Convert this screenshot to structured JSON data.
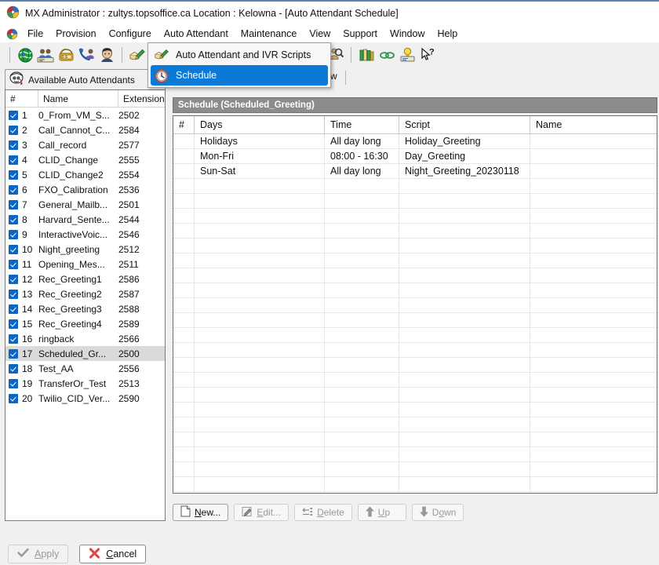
{
  "window": {
    "title": "MX Administrator : zultys.topsoffice.ca   Location : Kelowna - [Auto Attendant Schedule]",
    "app_icon": "mx-administrator-icon"
  },
  "menubar": {
    "items": [
      {
        "label": "File"
      },
      {
        "label": "Provision"
      },
      {
        "label": "Configure"
      },
      {
        "label": "Auto Attendant"
      },
      {
        "label": "Maintenance"
      },
      {
        "label": "View"
      },
      {
        "label": "Support"
      },
      {
        "label": "Window"
      },
      {
        "label": "Help"
      }
    ]
  },
  "toolbar": {
    "buttons": [
      {
        "name": "globe-icon"
      },
      {
        "name": "users-icon"
      },
      {
        "name": "phone-icon"
      },
      {
        "name": "call-transfer-icon"
      },
      {
        "name": "contact-icon"
      },
      {
        "name": "auto-attendant-icon"
      },
      {
        "name": "find-user-icon"
      },
      {
        "name": "books-icon"
      },
      {
        "name": "link-icon"
      },
      {
        "name": "hint-icon"
      },
      {
        "name": "help-pointer-icon"
      }
    ]
  },
  "dropdown": {
    "items": [
      {
        "label": "Auto Attendant and IVR Scripts",
        "icon": "auto-attendant-icon",
        "highlighted": false
      },
      {
        "label": "Schedule",
        "icon": "clock-icon",
        "highlighted": true
      }
    ]
  },
  "left_panel": {
    "tab_label": "Available Auto Attendants",
    "tab_icon": "auto-attendant-face-icon",
    "columns": [
      "#",
      "Name",
      "Extension"
    ],
    "rows": [
      {
        "num": "1",
        "name": "0_From_VM_S...",
        "ext": "2502",
        "checked": true,
        "selected": false
      },
      {
        "num": "2",
        "name": "Call_Cannot_C...",
        "ext": "2584",
        "checked": true,
        "selected": false
      },
      {
        "num": "3",
        "name": "Call_record",
        "ext": "2577",
        "checked": true,
        "selected": false
      },
      {
        "num": "4",
        "name": "CLID_Change",
        "ext": "2555",
        "checked": true,
        "selected": false
      },
      {
        "num": "5",
        "name": "CLID_Change2",
        "ext": "2554",
        "checked": true,
        "selected": false
      },
      {
        "num": "6",
        "name": "FXO_Calibration",
        "ext": "2536",
        "checked": true,
        "selected": false
      },
      {
        "num": "7",
        "name": "General_Mailb...",
        "ext": "2501",
        "checked": true,
        "selected": false
      },
      {
        "num": "8",
        "name": "Harvard_Sente...",
        "ext": "2544",
        "checked": true,
        "selected": false
      },
      {
        "num": "9",
        "name": "InteractiveVoic...",
        "ext": "2546",
        "checked": true,
        "selected": false
      },
      {
        "num": "10",
        "name": "Night_greeting",
        "ext": "2512",
        "checked": true,
        "selected": false
      },
      {
        "num": "11",
        "name": "Opening_Mes...",
        "ext": "2511",
        "checked": true,
        "selected": false
      },
      {
        "num": "12",
        "name": "Rec_Greeting1",
        "ext": "2586",
        "checked": true,
        "selected": false
      },
      {
        "num": "13",
        "name": "Rec_Greeting2",
        "ext": "2587",
        "checked": true,
        "selected": false
      },
      {
        "num": "14",
        "name": "Rec_Greeting3",
        "ext": "2588",
        "checked": true,
        "selected": false
      },
      {
        "num": "15",
        "name": "Rec_Greeting4",
        "ext": "2589",
        "checked": true,
        "selected": false
      },
      {
        "num": "16",
        "name": "ringback",
        "ext": "2566",
        "checked": true,
        "selected": false
      },
      {
        "num": "17",
        "name": "Scheduled_Gr...",
        "ext": "2500",
        "checked": true,
        "selected": true
      },
      {
        "num": "18",
        "name": "Test_AA",
        "ext": "2556",
        "checked": true,
        "selected": false
      },
      {
        "num": "19",
        "name": "TransferOr_Test",
        "ext": "2513",
        "checked": true,
        "selected": false
      },
      {
        "num": "20",
        "name": "Twilio_CID_Ver...",
        "ext": "2590",
        "checked": true,
        "selected": false
      }
    ]
  },
  "schedule": {
    "title": "Schedule (Scheduled_Greeting)",
    "columns": [
      "#",
      "Days",
      "Time",
      "Script",
      "Name"
    ],
    "rows": [
      {
        "num": "",
        "days": "Holidays",
        "time": "All day long",
        "script": "Holiday_Greeting",
        "name": ""
      },
      {
        "num": "",
        "days": "Mon-Fri",
        "time": "08:00 - 16:30",
        "script": "Day_Greeting",
        "name": ""
      },
      {
        "num": "",
        "days": "Sun-Sat",
        "time": "All day long",
        "script": "Night_Greeting_20230118",
        "name": ""
      }
    ],
    "empty_row_count": 21,
    "actions": [
      {
        "label": "New...",
        "icon": "new-page-icon",
        "enabled": true,
        "accel_index": 0
      },
      {
        "label": "Edit...",
        "icon": "edit-pencil-icon",
        "enabled": false,
        "accel_index": 0
      },
      {
        "label": "Delete",
        "icon": "delete-icon",
        "enabled": false,
        "accel_index": 0
      },
      {
        "label": "Up",
        "icon": "arrow-up-icon",
        "enabled": false,
        "accel_index": 0
      },
      {
        "label": "Down",
        "icon": "arrow-down-icon",
        "enabled": false,
        "accel_index": 1
      }
    ]
  },
  "footer": {
    "apply": {
      "label": "Apply",
      "icon": "checkmark-icon",
      "enabled": false
    },
    "cancel": {
      "label": "Cancel",
      "icon": "red-x-icon",
      "enabled": true
    }
  },
  "colors": {
    "accent_blue": "#0b7ad6",
    "checkbox_blue": "#0b66c3",
    "panel_bg": "#f0f0f0",
    "title_bar_grey": "#8c8c8c",
    "selection_grey": "#dadada"
  }
}
